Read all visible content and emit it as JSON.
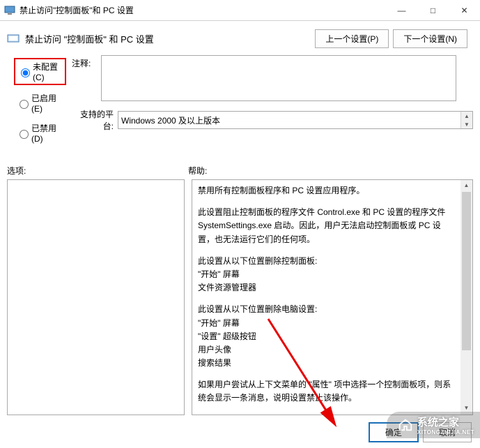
{
  "titlebar": {
    "title": "禁止访问\"控制面板\"和 PC 设置"
  },
  "header": {
    "title": "禁止访问 \"控制面板\" 和 PC 设置"
  },
  "nav": {
    "prev": "上一个设置(P)",
    "next": "下一个设置(N)"
  },
  "radios": {
    "not_configured": "未配置(C)",
    "enabled": "已启用(E)",
    "disabled": "已禁用(D)"
  },
  "comment": {
    "label": "注释:",
    "value": ""
  },
  "platform": {
    "label": "支持的平台:",
    "value": "Windows 2000 及以上版本"
  },
  "mid": {
    "options_label": "选项:",
    "help_label": "帮助:"
  },
  "help": {
    "p1": "禁用所有控制面板程序和 PC 设置应用程序。",
    "p2": "此设置阻止控制面板的程序文件 Control.exe 和 PC 设置的程序文件 SystemSettings.exe 启动。因此，用户无法启动控制面板或 PC 设置，也无法运行它们的任何项。",
    "p3": "此设置从以下位置删除控制面板:",
    "p3a": "\"开始\" 屏幕",
    "p3b": "文件资源管理器",
    "p4": "此设置从以下位置删除电脑设置:",
    "p4a": "\"开始\" 屏幕",
    "p4b": "\"设置\" 超级按钮",
    "p4c": "用户头像",
    "p4d": "搜索结果",
    "p5": "如果用户尝试从上下文菜单的 \"属性\" 项中选择一个控制面板项，则系统会显示一条消息，说明设置禁止该操作。"
  },
  "footer": {
    "ok": "确定",
    "cancel": "取消"
  },
  "watermark": {
    "text": "系统之家",
    "url": "XITONGZHIJIA.NET"
  }
}
